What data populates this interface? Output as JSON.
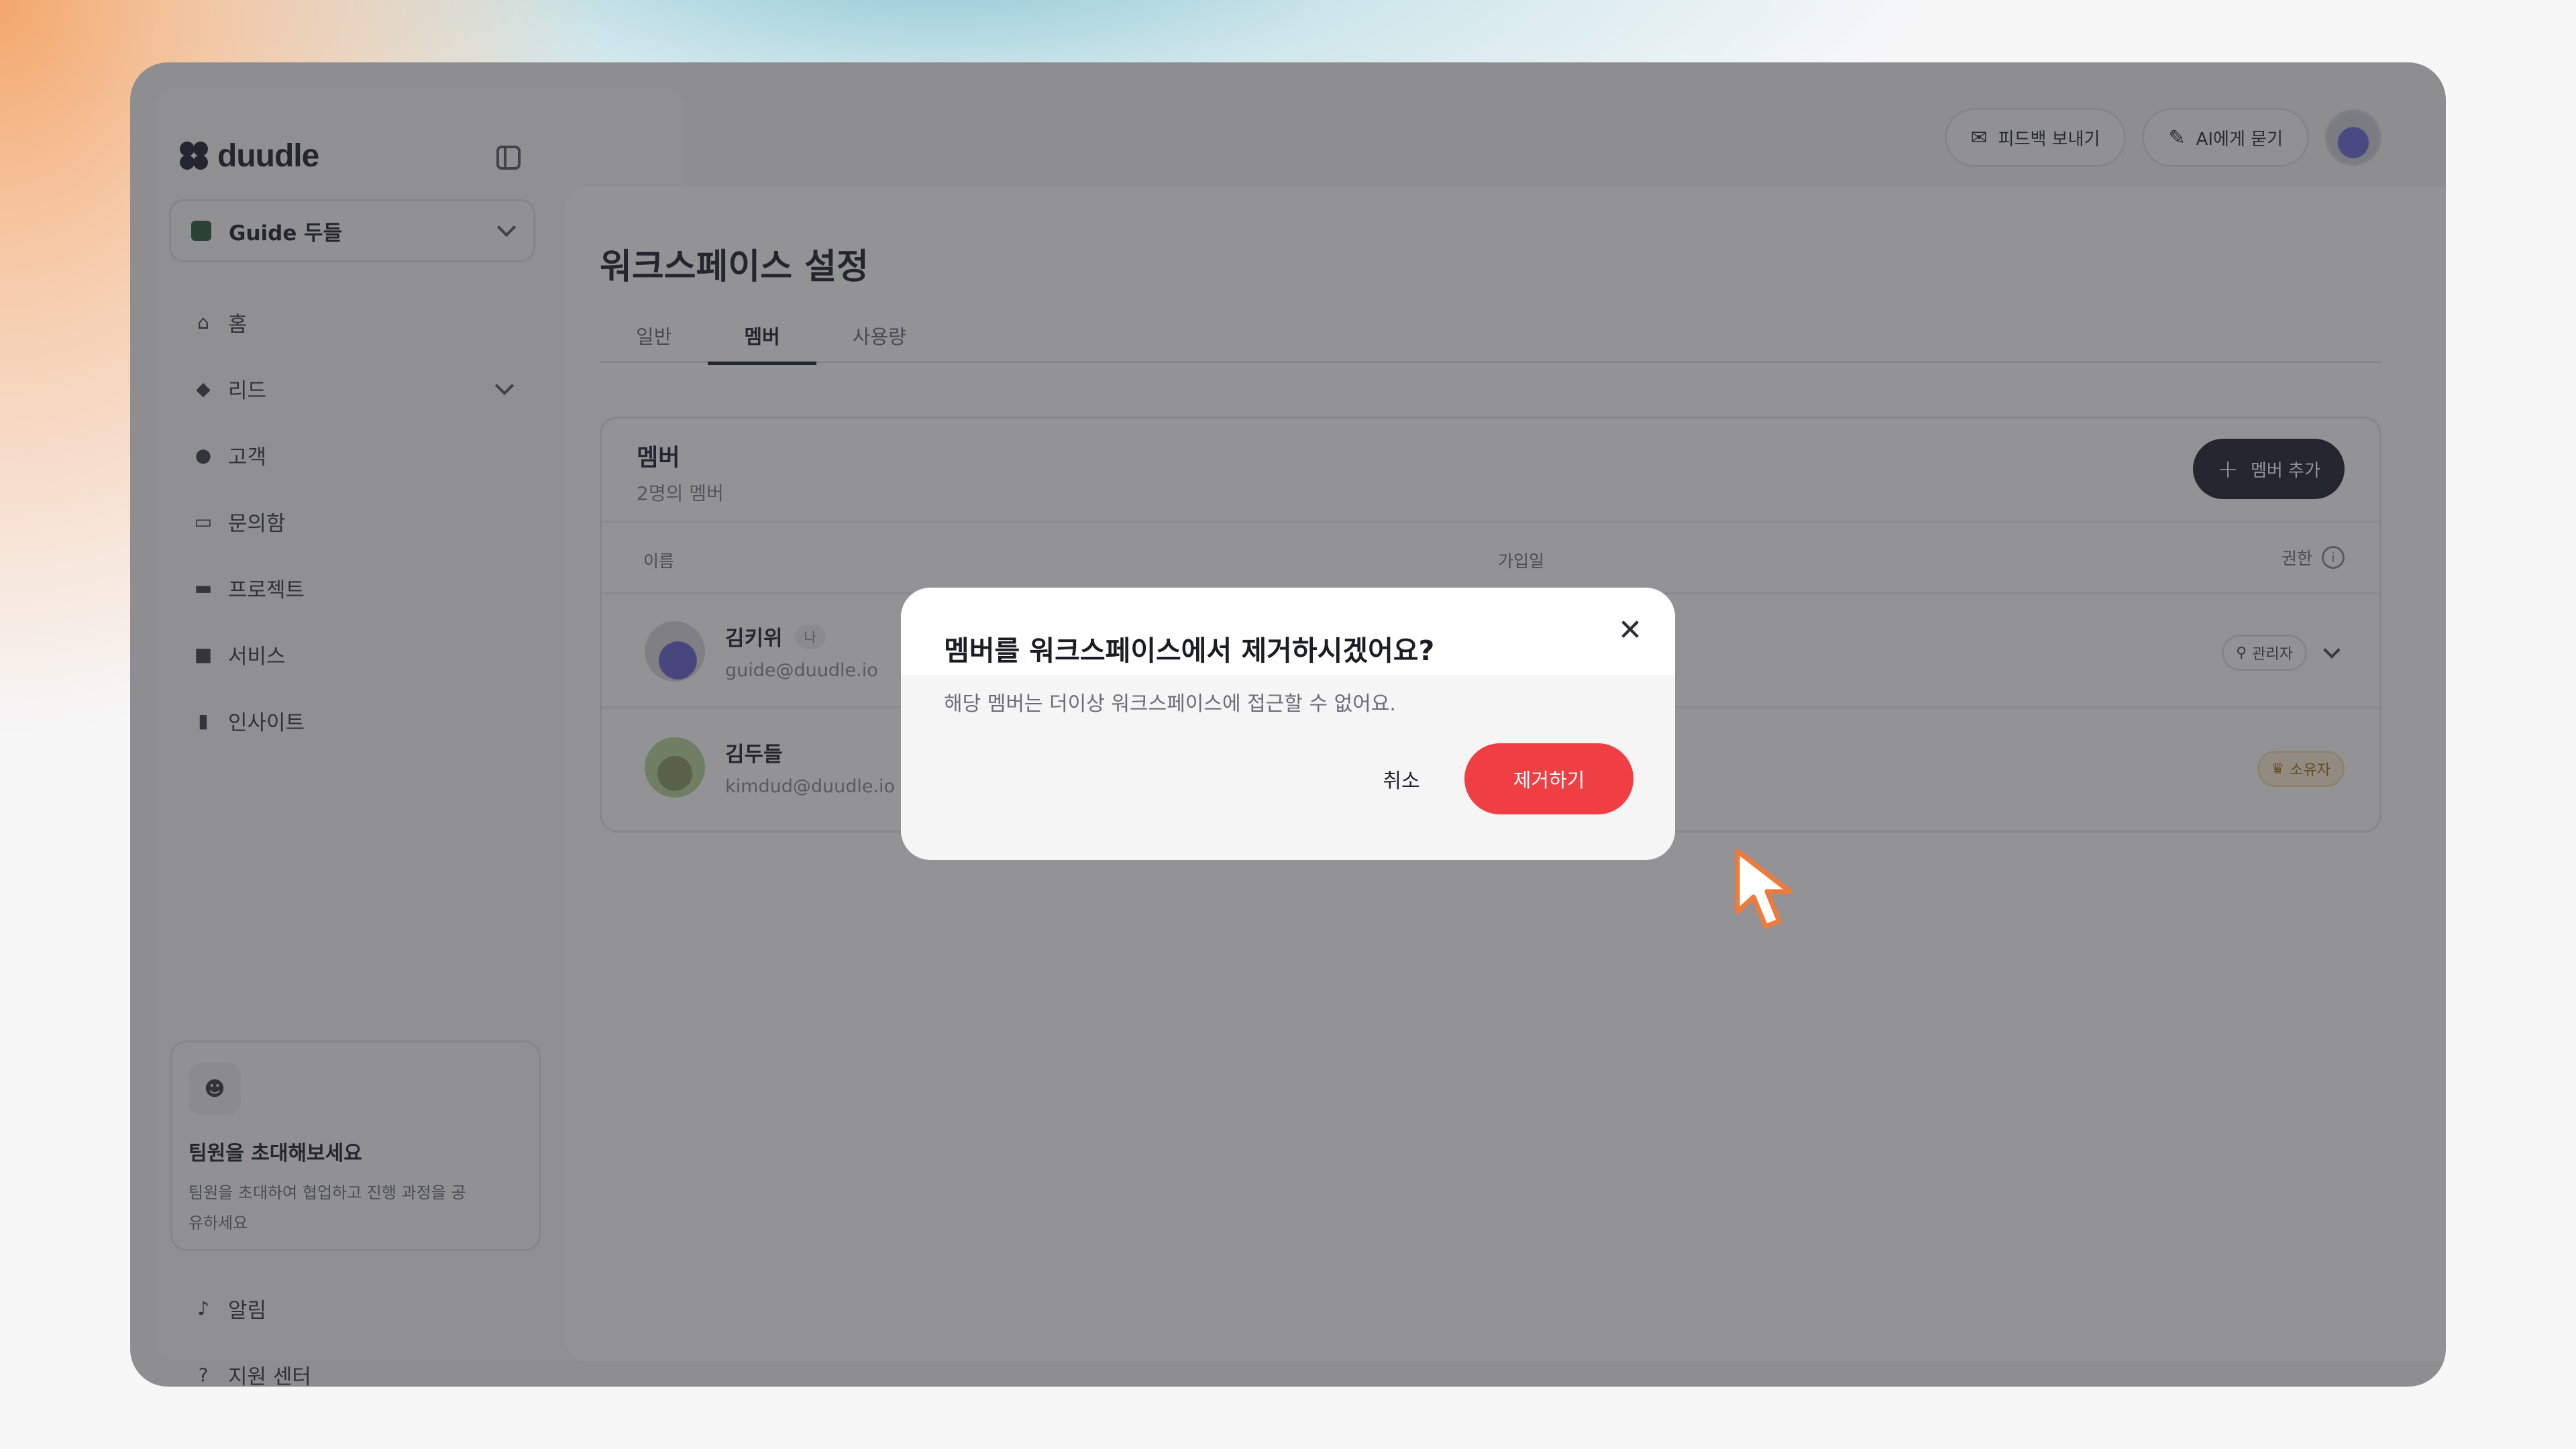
{
  "app": {
    "logo_text": "duudle"
  },
  "sidebar": {
    "workspace_name": "Guide 두들",
    "items": [
      {
        "label": "홈",
        "icon": "home-icon"
      },
      {
        "label": "리드",
        "icon": "tag-icon"
      },
      {
        "label": "고객",
        "icon": "user-icon"
      },
      {
        "label": "문의함",
        "icon": "inbox-icon"
      },
      {
        "label": "프로젝트",
        "icon": "folder-icon"
      },
      {
        "label": "서비스",
        "icon": "briefcase-icon"
      },
      {
        "label": "인사이트",
        "icon": "chart-icon"
      }
    ],
    "invite": {
      "title": "팀원을 초대해보세요",
      "desc": "팀원을 초대하여 협업하고 진행 과정을 공유하세요"
    },
    "bottom_items": [
      {
        "label": "알림",
        "icon": "bell-icon"
      },
      {
        "label": "지원 센터",
        "icon": "help-icon"
      }
    ]
  },
  "topbar": {
    "feedback_label": "피드백 보내기",
    "ask_ai_label": "AI에게 묻기"
  },
  "main": {
    "page_title": "워크스페이스 설정",
    "tabs": [
      {
        "label": "일반"
      },
      {
        "label": "멤버",
        "active": true
      },
      {
        "label": "사용량"
      }
    ],
    "members": {
      "title": "멤버",
      "subtitle": "2명의 멤버",
      "add_label": "멤버 추가",
      "columns": {
        "name": "이름",
        "joined": "가입일",
        "role": "권한"
      },
      "rows": [
        {
          "name": "김키위",
          "badge": "나",
          "email": "guide@duudle.io",
          "role": "관리자"
        },
        {
          "name": "김두들",
          "email": "kimdud@duudle.io",
          "role": "소유자"
        }
      ]
    }
  },
  "modal": {
    "title": "멤버를 워크스페이스에서 제거하시겠어요?",
    "desc": "해당 멤버는 더이상 워크스페이스에 접근할 수 없어요.",
    "cancel_label": "취소",
    "confirm_label": "제거하기"
  },
  "colors": {
    "danger": "#ef3f44",
    "primary_dark": "#1f2433",
    "owner_badge_bg": "#fcefd9",
    "cursor_accent": "#f07a3a"
  }
}
